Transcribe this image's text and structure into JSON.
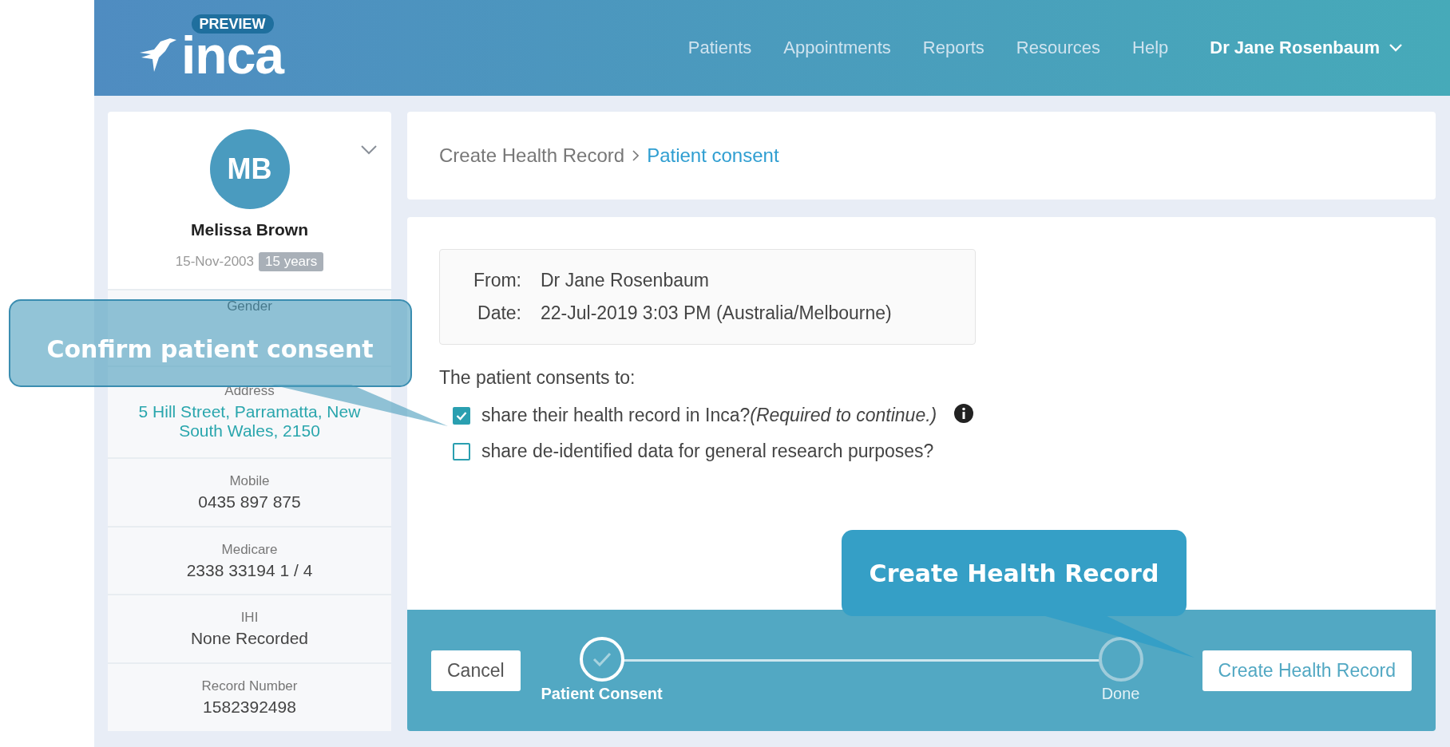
{
  "header": {
    "logo_text": "inca",
    "badge": "PREVIEW",
    "nav": [
      "Patients",
      "Appointments",
      "Reports",
      "Resources",
      "Help"
    ],
    "user": "Dr Jane Rosenbaum"
  },
  "patient": {
    "initials": "MB",
    "name": "Melissa Brown",
    "dob": "15-Nov-2003",
    "age": "15 years",
    "fields": [
      {
        "label": "Gender"
      },
      {
        "label": "Address",
        "value": "5 Hill Street, Parramatta, New South Wales, 2150",
        "kind": "link"
      },
      {
        "label": "Mobile",
        "value": "0435 897 875",
        "kind": "text"
      },
      {
        "label": "Medicare",
        "value": "2338 33194 1 / 4",
        "kind": "text"
      },
      {
        "label": "IHI",
        "value": "None Recorded",
        "kind": "text"
      },
      {
        "label": "Record Number",
        "value": "1582392498",
        "kind": "text"
      }
    ]
  },
  "breadcrumb": [
    {
      "label": "Create Health Record",
      "selected": false
    },
    {
      "label": "Patient consent",
      "selected": true
    }
  ],
  "message": [
    {
      "label": "From:",
      "value": "Dr Jane Rosenbaum"
    },
    {
      "label": "Date:",
      "value": "22-Jul-2019 3:03 PM (Australia/Melbourne)"
    }
  ],
  "consent_heading": "The patient consents to:",
  "consents": [
    {
      "text": "share their health record in Inca?",
      "note": "(Required to continue.)",
      "checked": true,
      "info": true
    },
    {
      "text": "share de-identified data for general research purposes?",
      "checked": false
    }
  ],
  "footer": {
    "cancel": "Cancel",
    "steps": [
      {
        "label": "Patient Consent",
        "done": true
      },
      {
        "label": "Done",
        "done": false
      }
    ],
    "submit": "Create Health Record"
  },
  "callouts": [
    "Confirm patient consent",
    "Create Health Record"
  ]
}
